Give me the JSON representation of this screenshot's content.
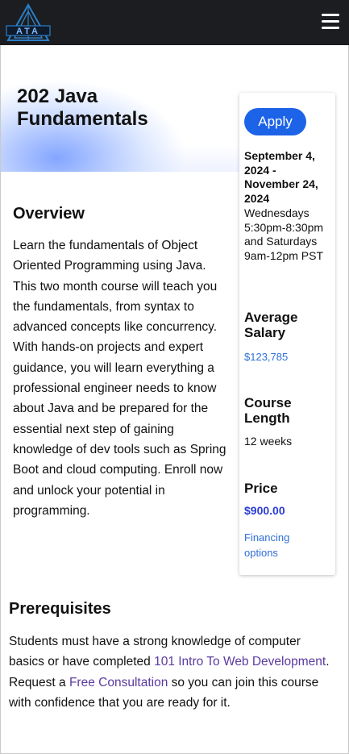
{
  "header": {
    "logo_text": "ATA",
    "menu_icon": "hamburger-menu-icon"
  },
  "hero": {
    "title": "202 Java Fundamentals"
  },
  "card": {
    "apply_label": "Apply",
    "dates": "September 4, 2024 - November 24, 2024",
    "schedule": "Wednesdays 5:30pm-8:30pm and Saturdays 9am-12pm PST",
    "salary_heading": "Average Salary",
    "salary_value": "$123,785",
    "length_heading": "Course Length",
    "length_value": "12 weeks",
    "price_heading": "Price",
    "price_value": "$900.00",
    "financing_link": "Financing options"
  },
  "overview": {
    "title": "Overview",
    "body": "Learn the fundamentals of Object Oriented Programming using Java. This two month course will teach you the fundamentals, from syntax to advanced concepts like concurrency. With hands-on projects and expert guidance, you will learn everything a professional engineer needs to know about Java and be prepared for the essential next step of gaining knowledge of dev tools such as Spring Boot and cloud computing. Enroll now and unlock your potential in programming."
  },
  "prerequisites": {
    "title": "Prerequisites",
    "text_1": "Students must have a strong knowledge of computer basics or have completed ",
    "link_1": "101 Intro To Web Development",
    "text_2": ". Request a ",
    "link_2": "Free Consultation",
    "text_3": " so you can join this course with confidence that you are ready for it."
  },
  "colors": {
    "header_bg": "#1b1d21",
    "apply_button": "#1d63e8",
    "link_blue": "#2f6fd8",
    "price": "#2b3cd6",
    "link_purple": "#5b3aa0"
  }
}
